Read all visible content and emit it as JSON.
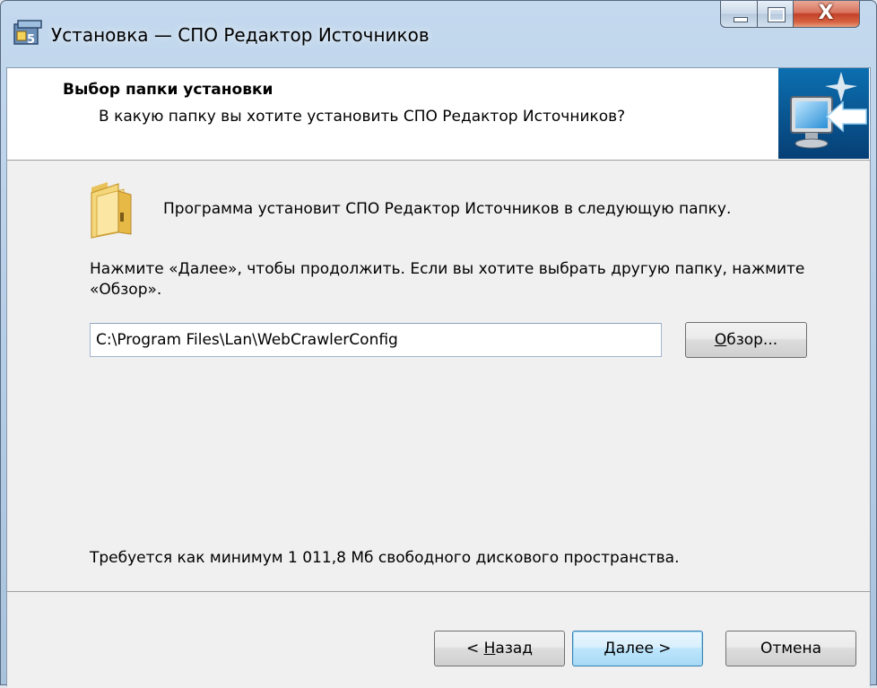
{
  "window": {
    "title": "Установка — СПО Редактор Источников",
    "controls": {
      "minimize_icon": "minimize-icon",
      "maximize_icon": "maximize-icon",
      "close_label": "X"
    }
  },
  "header": {
    "title": "Выбор папки установки",
    "subtitle": "В какую папку вы хотите установить СПО Редактор Источников?",
    "image_icon": "monitor-arrow-icon"
  },
  "body": {
    "intro": "Программа установит СПО Редактор Источников в следующую папку.",
    "instruction": "Нажмите «Далее», чтобы продолжить. Если вы хотите выбрать другую папку, нажмите «Обзор».",
    "path_value": "C:\\Program Files\\Lan\\WebCrawlerConfig",
    "browse": {
      "accel": "О",
      "rest": "бзор..."
    },
    "space_required": "Требуется как минимум 1 011,8 Мб свободного дискового пространства."
  },
  "footer": {
    "back": {
      "prefix": "< ",
      "accel": "Н",
      "rest": "азад"
    },
    "next_label": "Далее >",
    "cancel_label": "Отмена"
  },
  "colors": {
    "accent": "#3c7fb1",
    "close_button": "#c4412a",
    "frame": "#b3cbe4"
  }
}
